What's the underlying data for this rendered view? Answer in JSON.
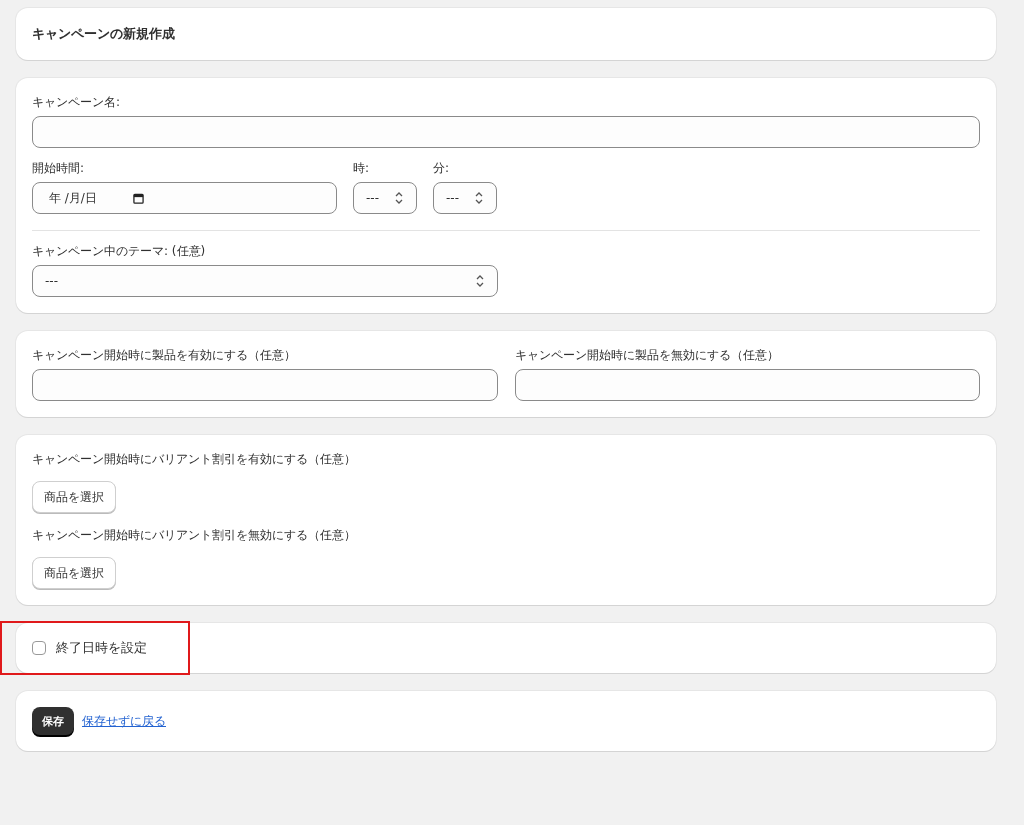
{
  "page_title": "キャンペーンの新規作成",
  "campaign_name": {
    "label": "キャンペーン名:"
  },
  "start": {
    "label": "開始時間:",
    "date_placeholder": "年 /月/日"
  },
  "hour": {
    "label": "時:",
    "value": "---"
  },
  "minute": {
    "label": "分:",
    "value": "---"
  },
  "theme": {
    "label": "キャンペーン中のテーマ: (任意)",
    "value": "---"
  },
  "products": [
    {
      "label": "キャンペーン開始時に製品を有効にする（任意）"
    },
    {
      "label": "キャンペーン開始時に製品を無効にする（任意）"
    }
  ],
  "variant_discounts": [
    {
      "label": "キャンペーン開始時にバリアント割引を有効にする（任意）",
      "button": "商品を選択"
    },
    {
      "label": "キャンペーン開始時にバリアント割引を無効にする（任意）",
      "button": "商品を選択"
    }
  ],
  "end_date": {
    "label": "終了日時を設定",
    "checked": false
  },
  "actions": {
    "save": "保存",
    "back_link": "保存せずに戻る"
  }
}
